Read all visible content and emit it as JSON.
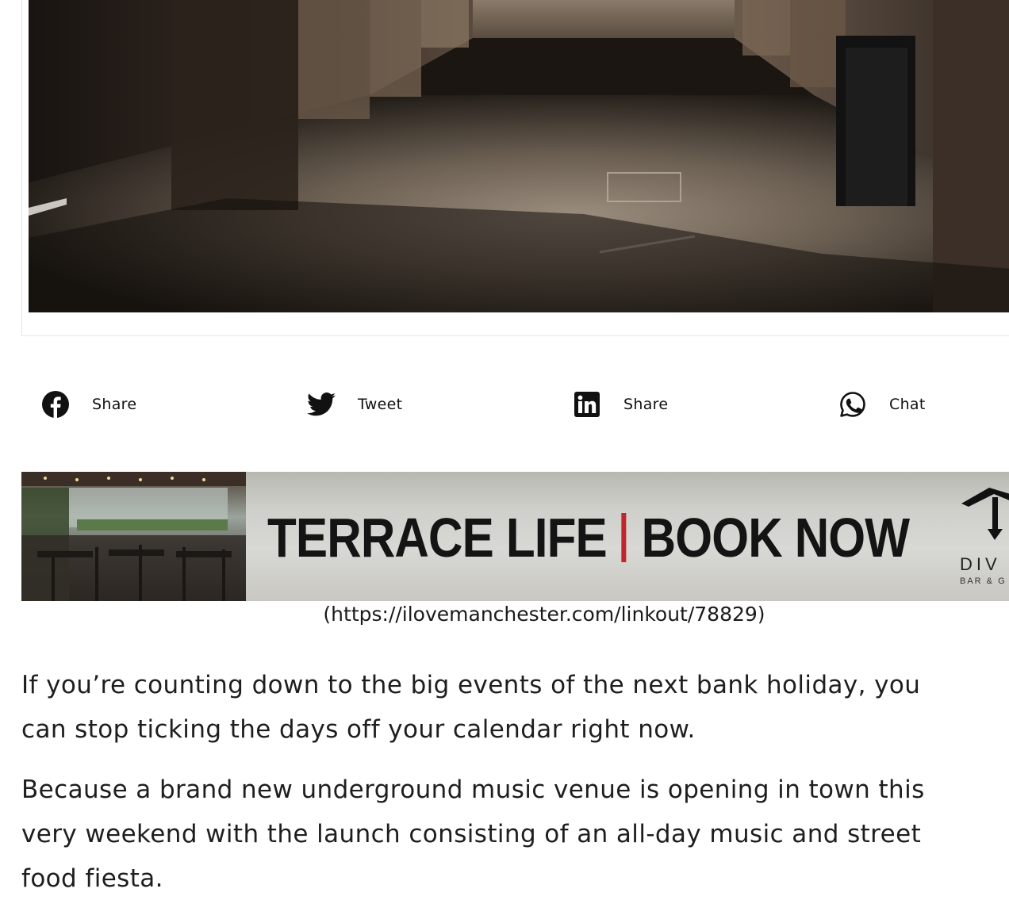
{
  "share_bar": {
    "items": [
      {
        "icon": "facebook-icon",
        "label": "Share"
      },
      {
        "icon": "twitter-icon",
        "label": "Tweet"
      },
      {
        "icon": "linkedin-icon",
        "label": "Share"
      },
      {
        "icon": "whatsapp-icon",
        "label": "Chat"
      }
    ]
  },
  "ad": {
    "headline_left": "TERRACE LIFE",
    "headline_right": "BOOK NOW",
    "logo_text": "DIV",
    "logo_subtext": "BAR & G",
    "link_text": "(https://ilovemanchester.com/linkout/78829)",
    "accent_color": "#c0272d"
  },
  "article": {
    "p1_line1": "If you’re counting down to the big events of the next bank holiday, you",
    "p1_line2": "can stop ticking the days off your calendar right now.",
    "p2_line1": "Because a brand new underground music venue is opening in town this",
    "p2_line2": "very weekend with the launch consisting of an all-day music and street",
    "p2_line3": "food fiesta."
  }
}
